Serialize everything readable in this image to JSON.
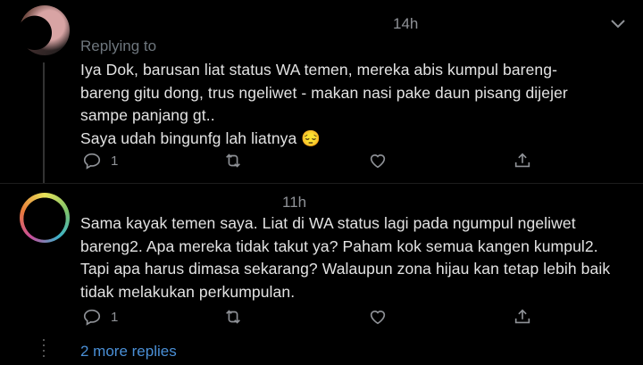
{
  "tweets": [
    {
      "time": "14h",
      "replying_to": "Replying to",
      "text": "Iya Dok, barusan liat status WA temen, mereka abis kumpul bareng-\nbareng gitu dong, trus ngeliwet - makan nasi pake daun pisang dijejer\nsampe panjang gt..\nSaya udah bingunfg lah liatnya",
      "emoji": "😔",
      "reply_count": "1"
    },
    {
      "time": "11h",
      "text": "Sama kayak temen saya. Liat di WA status lagi pada ngumpul ngeliwet\nbareng2. Apa mereka tidak takut ya? Paham kok semua kangen kumpul2.\nTapi apa harus dimasa sekarang? Walaupun zona hijau kan tetap lebih baik\ntidak melakukan perkumpulan.",
      "reply_count": "1"
    }
  ],
  "more_replies": "2 more replies",
  "icons": [
    "more-chevron-icon",
    "reply-icon",
    "retweet-icon",
    "like-icon",
    "share-icon"
  ],
  "colors": {
    "background": "#000000",
    "link": "#4a8fd6",
    "muted": "#8f9297"
  }
}
